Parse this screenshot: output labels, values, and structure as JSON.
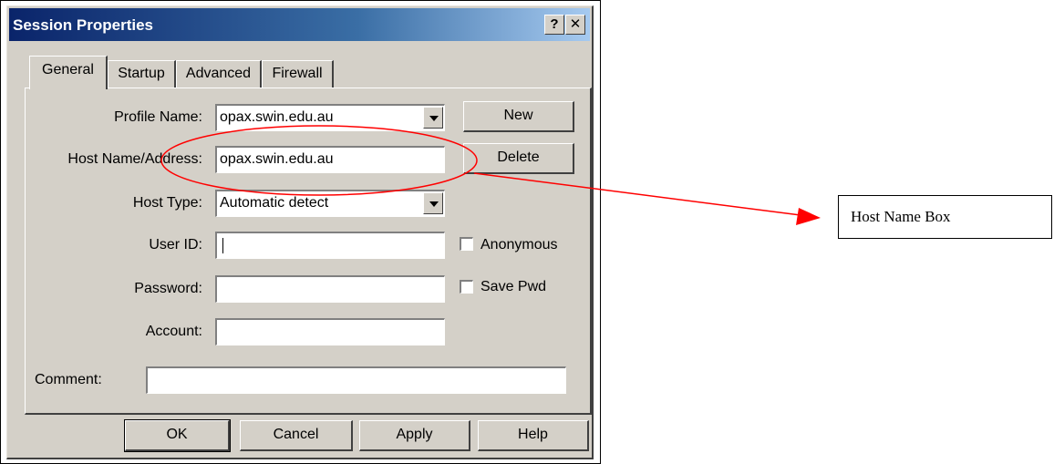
{
  "dialog": {
    "title": "Session Properties",
    "help_button": "?",
    "close_button": "✕"
  },
  "tabs": [
    {
      "label": "General"
    },
    {
      "label": "Startup"
    },
    {
      "label": "Advanced"
    },
    {
      "label": "Firewall"
    }
  ],
  "form": {
    "profile_name": {
      "label": "Profile Name:",
      "value": "opax.swin.edu.au"
    },
    "host_name": {
      "label": "Host Name/Address:",
      "value": "opax.swin.edu.au"
    },
    "host_type": {
      "label": "Host Type:",
      "value": "Automatic detect"
    },
    "user_id": {
      "label": "User ID:",
      "value": ""
    },
    "password": {
      "label": "Password:",
      "value": ""
    },
    "account": {
      "label": "Account:",
      "value": ""
    },
    "comment": {
      "label": "Comment:",
      "value": ""
    },
    "anonymous": {
      "label": "Anonymous",
      "checked": false
    },
    "save_pwd": {
      "label": "Save Pwd",
      "checked": false
    }
  },
  "side_buttons": {
    "new": "New",
    "delete": "Delete"
  },
  "bottom_buttons": {
    "ok": "OK",
    "cancel": "Cancel",
    "apply": "Apply",
    "help": "Help"
  },
  "annotation": {
    "text": "Host Name Box",
    "color": "#ff0000"
  }
}
